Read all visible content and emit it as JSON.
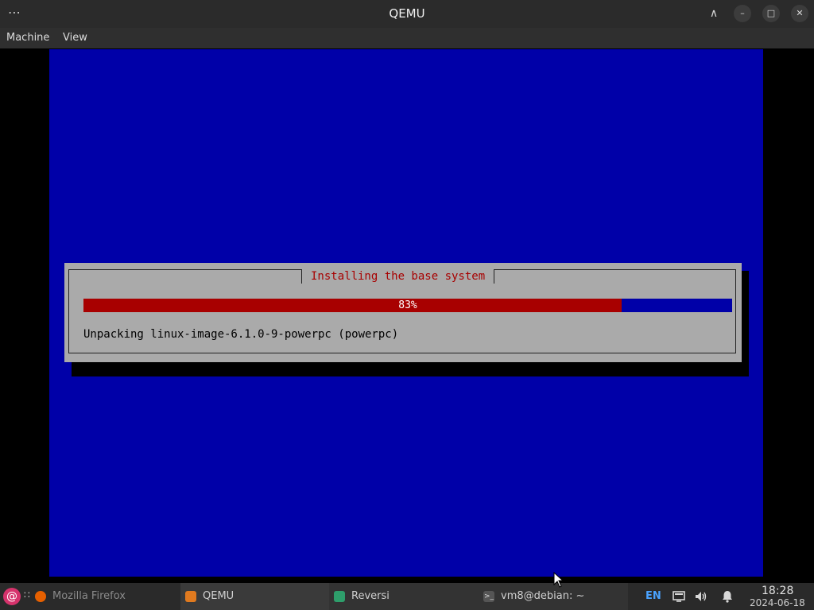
{
  "window": {
    "title": "QEMU",
    "menu_dots": "⋯",
    "controls": {
      "chevron": "∧",
      "minimize": "–",
      "maximize": "□",
      "close": "✕"
    }
  },
  "menubar": {
    "items": [
      "Machine",
      "View"
    ]
  },
  "installer": {
    "background_color": "#0000a8",
    "dialog_title": "Installing the base system",
    "progress_percent": 83,
    "progress_label": "83%",
    "status_text": "Unpacking linux-image-6.1.0-9-powerpc (powerpc)",
    "progress_fill_color": "#a80000"
  },
  "taskbar": {
    "start_icon": "@",
    "apps_icon": "∷",
    "tasks": [
      {
        "label": "Mozilla Firefox",
        "icon": "firefox-icon"
      },
      {
        "label": "QEMU",
        "icon": "qemu-icon"
      },
      {
        "label": "Reversi",
        "icon": "reversi-icon"
      },
      {
        "label": "vm8@debian: ~",
        "icon": "terminal-icon"
      }
    ],
    "tray": {
      "keyboard_layout": "EN",
      "time": "18:28",
      "date": "2024-06-18"
    }
  }
}
